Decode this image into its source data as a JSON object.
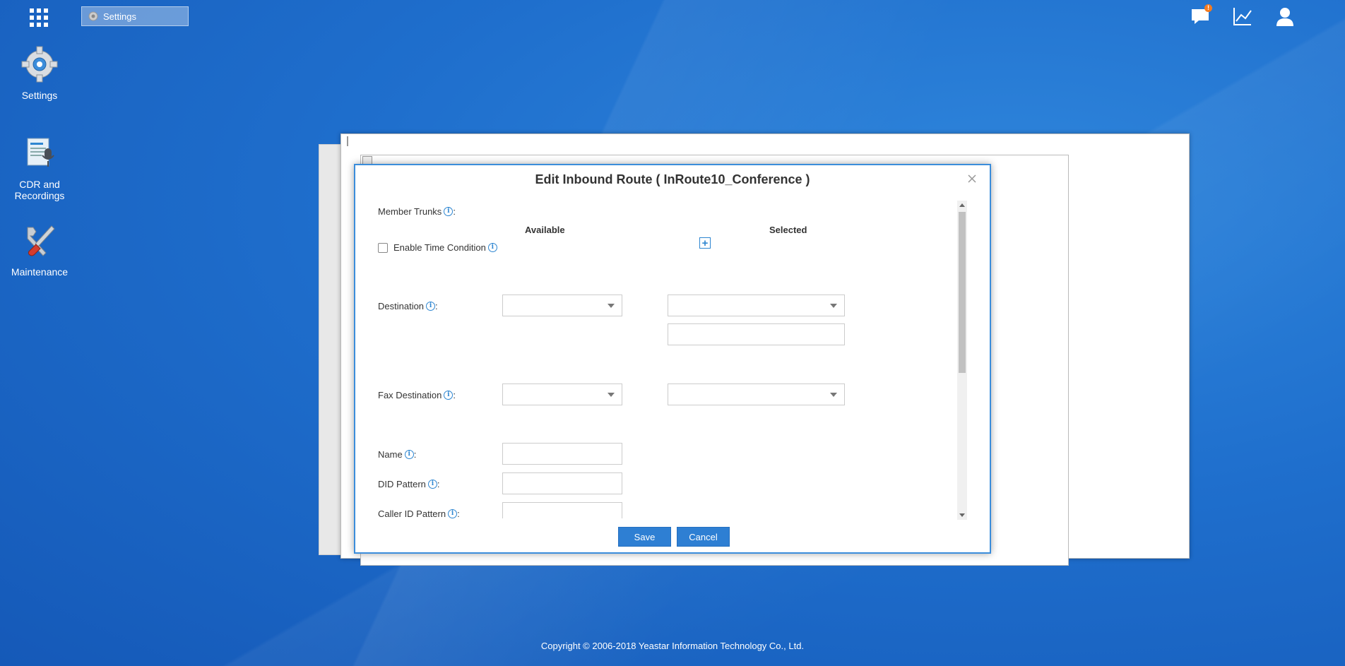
{
  "taskbar": {
    "tab_label": "Settings"
  },
  "notifications": {
    "badge": "!"
  },
  "desktop": {
    "settings": "Settings",
    "cdr_line1": "CDR and",
    "cdr_line2": "Recordings",
    "maintenance": "Maintenance"
  },
  "modal": {
    "title": "Edit Inbound Route ( InRoute10_Conference )",
    "member_trunks": "Member Trunks",
    "available": "Available",
    "selected": "Selected",
    "enable_time_condition": "Enable Time Condition",
    "destination": "Destination",
    "fax_destination": "Fax Destination",
    "name": "Name",
    "did_pattern": "DID Pattern",
    "caller_id_pattern": "Caller ID Pattern",
    "colon": ":",
    "save": "Save",
    "cancel": "Cancel"
  },
  "footer": {
    "copyright": "Copyright © 2006-2018 Yeastar Information Technology Co., Ltd."
  }
}
